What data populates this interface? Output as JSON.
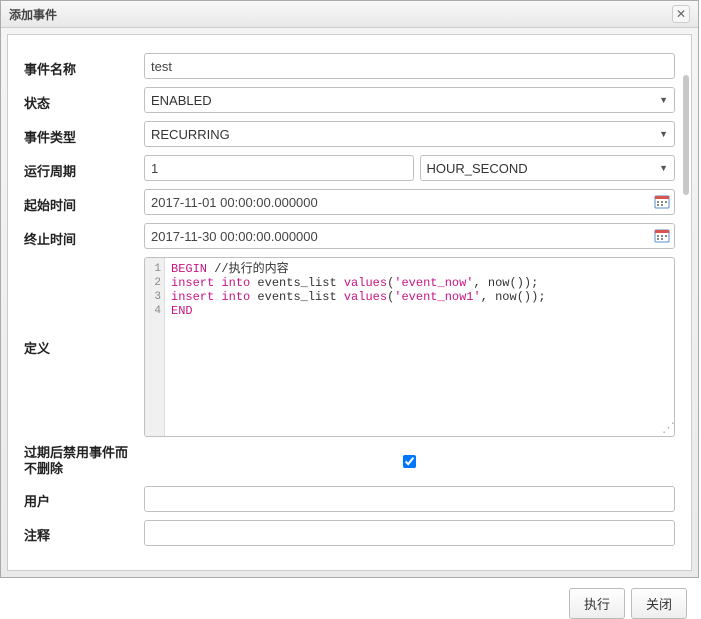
{
  "dialog": {
    "title": "添加事件",
    "close_icon": "✕"
  },
  "labels": {
    "event_name": "事件名称",
    "status": "状态",
    "event_type": "事件类型",
    "period": "运行周期",
    "start_time": "起始时间",
    "end_time": "终止时间",
    "definition": "定义",
    "disable_on_expire": "过期后禁用事件而不删除",
    "user": "用户",
    "comment": "注释"
  },
  "fields": {
    "event_name": "test",
    "status": "ENABLED",
    "event_type": "RECURRING",
    "period_value": "1",
    "period_unit": "HOUR_SECOND",
    "start_time": "2017-11-01 00:00:00.000000",
    "end_time": "2017-11-30 00:00:00.000000",
    "user": "",
    "comment": ""
  },
  "code": {
    "gutter": [
      "1",
      "2",
      "3",
      "4"
    ],
    "lines": [
      {
        "segments": [
          {
            "cls": "kw",
            "t": "BEGIN"
          },
          {
            "cls": "plain",
            "t": " //执行的内容"
          }
        ]
      },
      {
        "segments": [
          {
            "cls": "kw",
            "t": "insert"
          },
          {
            "cls": "plain",
            "t": " "
          },
          {
            "cls": "kw",
            "t": "into"
          },
          {
            "cls": "plain",
            "t": " events_list "
          },
          {
            "cls": "kw",
            "t": "values"
          },
          {
            "cls": "plain",
            "t": "("
          },
          {
            "cls": "str",
            "t": "'event_now'"
          },
          {
            "cls": "plain",
            "t": ", now());"
          }
        ]
      },
      {
        "segments": [
          {
            "cls": "kw",
            "t": "insert"
          },
          {
            "cls": "plain",
            "t": " "
          },
          {
            "cls": "kw",
            "t": "into"
          },
          {
            "cls": "plain",
            "t": " events_list "
          },
          {
            "cls": "kw",
            "t": "values"
          },
          {
            "cls": "plain",
            "t": "("
          },
          {
            "cls": "str",
            "t": "'event_now1'"
          },
          {
            "cls": "plain",
            "t": ", now());"
          }
        ]
      },
      {
        "segments": [
          {
            "cls": "kw",
            "t": "END"
          }
        ]
      }
    ]
  },
  "buttons": {
    "execute": "执行",
    "close": "关闭"
  }
}
